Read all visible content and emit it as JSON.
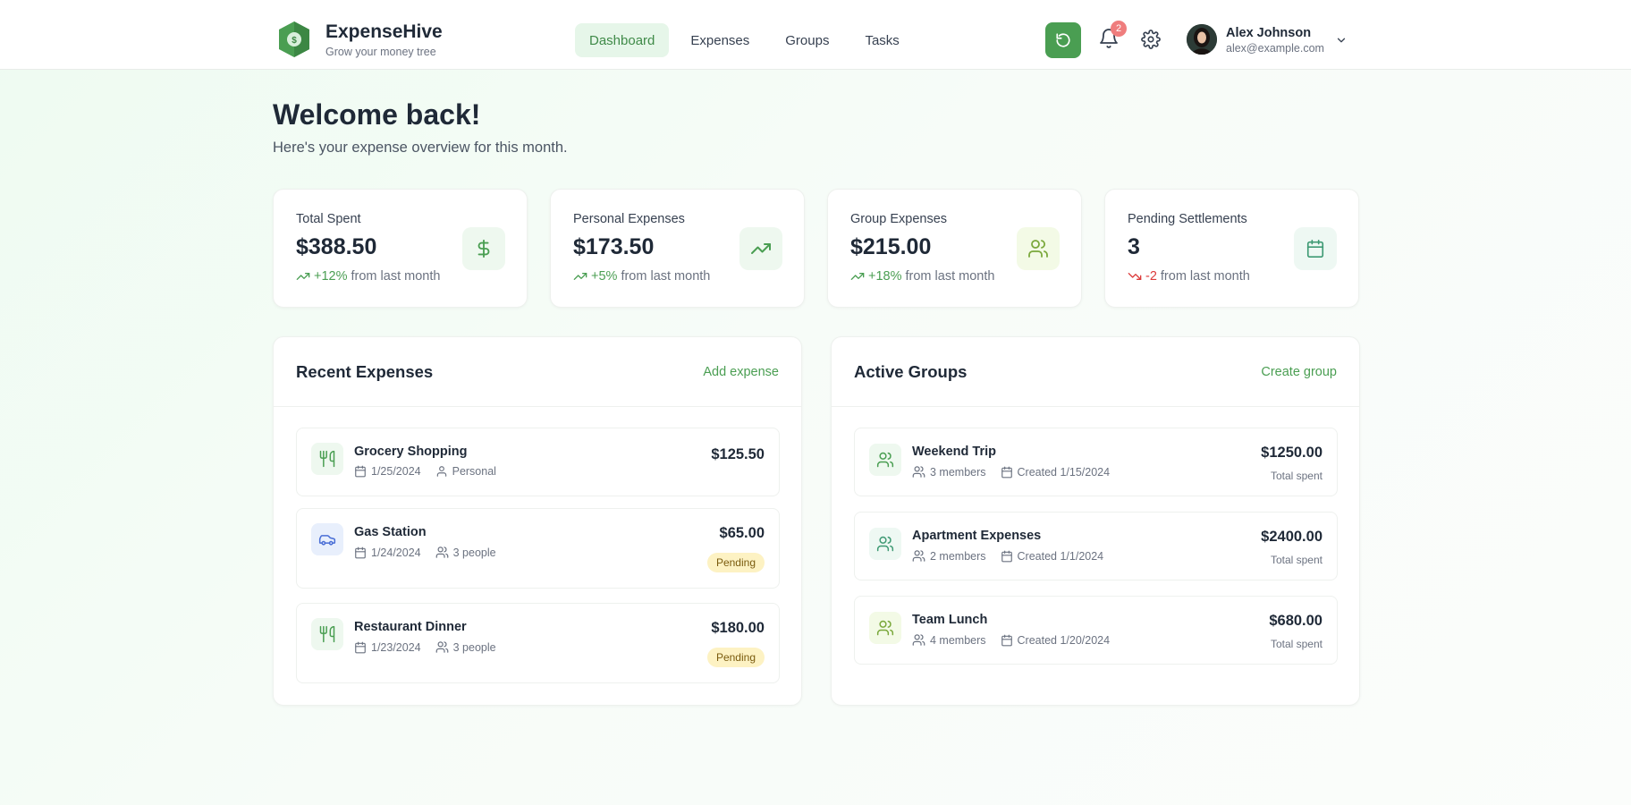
{
  "header": {
    "brand_name": "ExpenseHive",
    "brand_tagline": "Grow your money tree",
    "nav": [
      {
        "label": "Dashboard",
        "active": true
      },
      {
        "label": "Expenses",
        "active": false
      },
      {
        "label": "Groups",
        "active": false
      },
      {
        "label": "Tasks",
        "active": false
      }
    ],
    "notifications_count": "2",
    "user": {
      "name": "Alex Johnson",
      "email": "alex@example.com"
    }
  },
  "welcome": {
    "title": "Welcome back!",
    "subtitle": "Here's your expense overview for this month."
  },
  "stats": [
    {
      "label": "Total Spent",
      "value": "$388.50",
      "change": "+12%",
      "trend": "up",
      "suffix": "from last month",
      "icon": "dollar-icon",
      "icon_bg": "#eef8ef",
      "icon_color": "#4a9e52"
    },
    {
      "label": "Personal Expenses",
      "value": "$173.50",
      "change": "+5%",
      "trend": "up",
      "suffix": "from last month",
      "icon": "trending-up-icon",
      "icon_bg": "#eef8ef",
      "icon_color": "#4a9e52"
    },
    {
      "label": "Group Expenses",
      "value": "$215.00",
      "change": "+18%",
      "trend": "up",
      "suffix": "from last month",
      "icon": "users-icon",
      "icon_bg": "#f3fae6",
      "icon_color": "#7aa83b"
    },
    {
      "label": "Pending Settlements",
      "value": "3",
      "change": "-2",
      "trend": "down",
      "suffix": "from last month",
      "icon": "calendar-icon",
      "icon_bg": "#eef8f3",
      "icon_color": "#3f9a74"
    }
  ],
  "recent_expenses": {
    "title": "Recent Expenses",
    "action": "Add expense",
    "items": [
      {
        "title": "Grocery Shopping",
        "date": "1/25/2024",
        "meta": "Personal",
        "amount": "$125.50",
        "status": "",
        "icon": "utensils-icon"
      },
      {
        "title": "Gas Station",
        "date": "1/24/2024",
        "meta": "3 people",
        "amount": "$65.00",
        "status": "Pending",
        "icon": "car-icon"
      },
      {
        "title": "Restaurant Dinner",
        "date": "1/23/2024",
        "meta": "3 people",
        "amount": "$180.00",
        "status": "Pending",
        "icon": "utensils-icon"
      }
    ]
  },
  "active_groups": {
    "title": "Active Groups",
    "action": "Create group",
    "items": [
      {
        "title": "Weekend Trip",
        "members": "3 members",
        "created": "Created 1/15/2024",
        "amount": "$1250.00",
        "sub": "Total spent"
      },
      {
        "title": "Apartment Expenses",
        "members": "2 members",
        "created": "Created 1/1/2024",
        "amount": "$2400.00",
        "sub": "Total spent"
      },
      {
        "title": "Team Lunch",
        "members": "4 members",
        "created": "Created 1/20/2024",
        "amount": "$680.00",
        "sub": "Total spent"
      }
    ]
  },
  "colors": {
    "brand": "#4a9e52",
    "up": "#4a9e52",
    "down": "#dc3b3b",
    "pending_bg": "#fdf2c3"
  }
}
